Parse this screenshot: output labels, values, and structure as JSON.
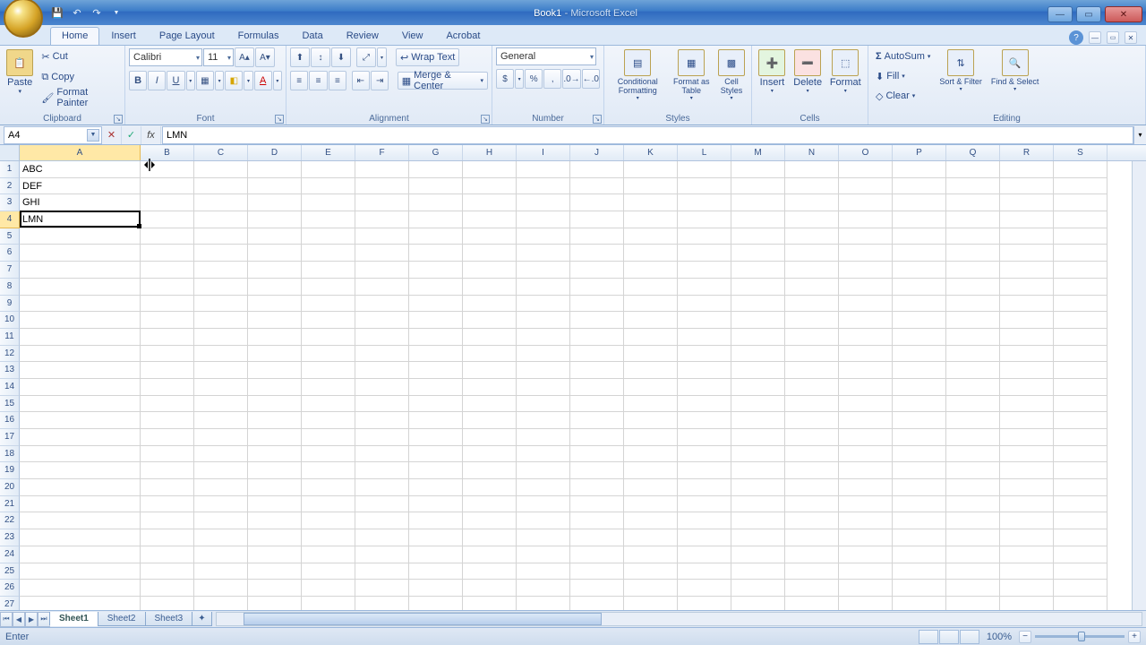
{
  "title": {
    "doc": "Book1",
    "app": "Microsoft Excel"
  },
  "tabs": [
    "Home",
    "Insert",
    "Page Layout",
    "Formulas",
    "Data",
    "Review",
    "View",
    "Acrobat"
  ],
  "active_tab": 0,
  "clipboard": {
    "paste": "Paste",
    "cut": "Cut",
    "copy": "Copy",
    "painter": "Format Painter",
    "label": "Clipboard"
  },
  "font": {
    "name": "Calibri",
    "size": "11",
    "label": "Font"
  },
  "alignment": {
    "wrap": "Wrap Text",
    "merge": "Merge & Center",
    "label": "Alignment"
  },
  "number": {
    "format": "General",
    "label": "Number"
  },
  "styles": {
    "cond": "Conditional Formatting",
    "table": "Format as Table",
    "cell": "Cell Styles",
    "label": "Styles"
  },
  "cells": {
    "insert": "Insert",
    "delete": "Delete",
    "format": "Format",
    "label": "Cells"
  },
  "editing": {
    "sum": "AutoSum",
    "fill": "Fill",
    "clear": "Clear",
    "sort": "Sort & Filter",
    "find": "Find & Select",
    "label": "Editing"
  },
  "namebox": "A4",
  "formula": "LMN",
  "columns": [
    "A",
    "B",
    "C",
    "D",
    "E",
    "F",
    "G",
    "H",
    "I",
    "J",
    "K",
    "L",
    "M",
    "N",
    "O",
    "P",
    "Q",
    "R",
    "S"
  ],
  "col_widths": {
    "A": 135
  },
  "active_col": "A",
  "active_row": 4,
  "rows": 27,
  "data": {
    "A1": "ABC",
    "A2": "DEF",
    "A3": "GHI",
    "A4": "LMN"
  },
  "sheets": [
    "Sheet1",
    "Sheet2",
    "Sheet3"
  ],
  "active_sheet": 0,
  "status": "Enter",
  "zoom": "100%"
}
